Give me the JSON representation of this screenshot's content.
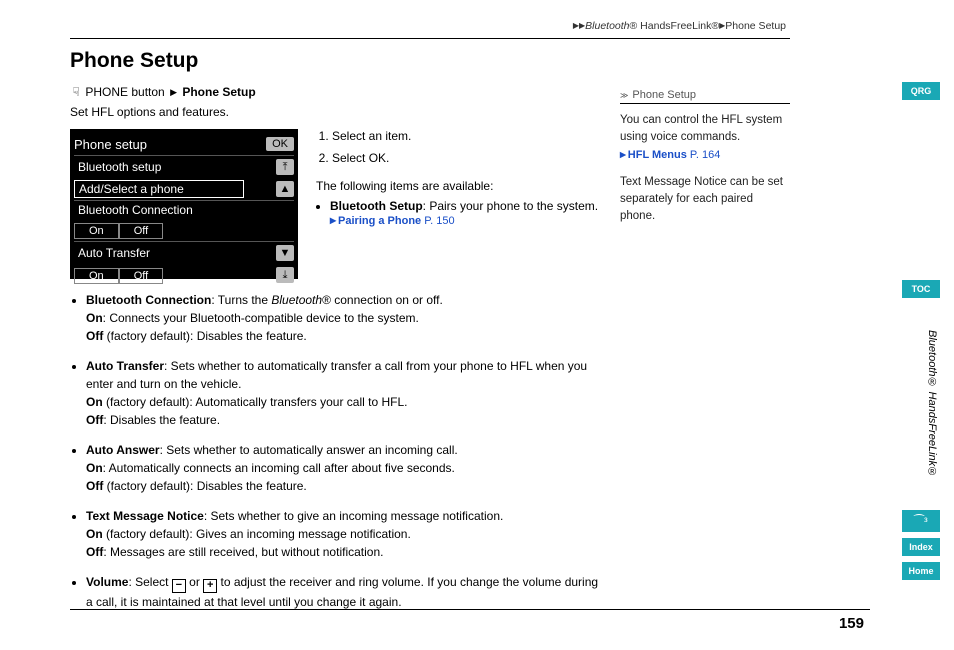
{
  "breadcrumb": {
    "seg1": "Bluetooth",
    "seg1_suffix": "® HandsFreeLink®",
    "seg2": "Phone Setup"
  },
  "title": "Phone Setup",
  "nav_path": {
    "btn": "PHONE button",
    "dest": "Phone Setup"
  },
  "intro": "Set HFL options and features.",
  "device": {
    "title": "Phone setup",
    "ok": "OK",
    "bt_setup": "Bluetooth setup",
    "add_select": "Add/Select a phone",
    "bt_conn": "Bluetooth Connection",
    "on": "On",
    "off": "Off",
    "auto_transfer": "Auto Transfer"
  },
  "steps": {
    "s1": "Select an item.",
    "s2_pre": "Select ",
    "s2_btn": "OK",
    "s2_post": "."
  },
  "available_intro": "The following items are available:",
  "first_item": {
    "title": "Bluetooth Setup",
    "desc": ": Pairs your phone to the system.",
    "link": "Pairing a Phone",
    "page": "P. 150"
  },
  "bullets": [
    {
      "title": "Bluetooth Connection",
      "desc_pre": ": Turns the ",
      "desc_em": "Bluetooth",
      "desc_post": "® connection on or off.",
      "on": ": Connects your Bluetooth-compatible device to the system.",
      "off": " (factory default): Disables the feature."
    },
    {
      "title": "Auto Transfer",
      "desc": ": Sets whether to automatically transfer a call from your phone to HFL when you enter and turn on the vehicle.",
      "on": " (factory default): Automatically transfers your call to HFL.",
      "off": ": Disables the feature."
    },
    {
      "title": "Auto Answer",
      "desc": ": Sets whether to automatically answer an incoming call.",
      "on": ": Automatically connects an incoming call after about five seconds.",
      "off": " (factory default): Disables the feature."
    },
    {
      "title": "Text Message Notice",
      "desc": ": Sets whether to give an incoming message notification.",
      "on": " (factory default): Gives an incoming message notification.",
      "off": ": Messages are still received, but without notification."
    }
  ],
  "volume": {
    "title": "Volume",
    "pre": ": Select ",
    "mid": " or ",
    "post": " to adjust the receiver and ring volume. If you change the volume during a call, it is maintained at that level until you change it again."
  },
  "side": {
    "head": "Phone Setup",
    "p1": "You can control the HFL system using voice commands.",
    "link": "HFL Menus",
    "link_page": "P. 164",
    "p2": "Text Message Notice can be set separately for each paired phone."
  },
  "edge": {
    "qrg": "QRG",
    "toc": "TOC",
    "voice": "⁀ᵌ",
    "index": "Index",
    "home": "Home",
    "section": "Bluetooth® HandsFreeLink®"
  },
  "labels": {
    "on": "On",
    "off": "Off"
  },
  "page_number": "159"
}
